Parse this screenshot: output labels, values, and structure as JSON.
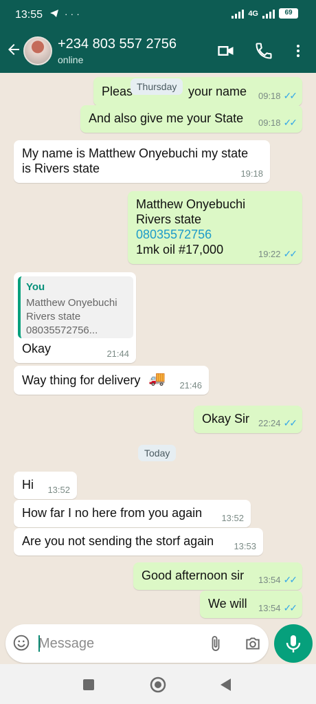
{
  "status_bar": {
    "time": "13:55",
    "network": "4G",
    "battery": "69"
  },
  "header": {
    "contact_name": "+234 803 557 2756",
    "contact_status": "online"
  },
  "messages": [
    {
      "id": "m1",
      "dir": "out",
      "text": "Pleas",
      "text2": "your name",
      "time": "09:18",
      "ticks": "✓✓"
    },
    {
      "id": "m2",
      "dir": "out",
      "text": "And also give me your State",
      "time": "09:18",
      "ticks": "✓✓"
    },
    {
      "id": "m3",
      "dir": "in",
      "text": "My name is Matthew Onyebuchi my state\nis Rivers state",
      "time": "19:18"
    },
    {
      "id": "m4",
      "dir": "out",
      "line1": "Matthew Onyebuchi",
      "line2": "Rivers state",
      "phone": "08035572756",
      "line4": "1mk oil #17,000",
      "time": "19:22",
      "ticks": "✓✓"
    },
    {
      "id": "m5",
      "dir": "in",
      "quote_author": "You",
      "quote_lines": [
        "Matthew Onyebuchi",
        "Rivers state",
        "08035572756..."
      ],
      "text": "Okay",
      "time": "21:44"
    },
    {
      "id": "m6",
      "dir": "in",
      "text": "Way thing for delivery",
      "emoji": "🚚",
      "time": "21:46"
    },
    {
      "id": "m7",
      "dir": "out",
      "text": "Okay Sir",
      "time": "22:24",
      "ticks": "✓✓"
    },
    {
      "id": "m8",
      "dir": "in",
      "text": "Hi",
      "time": "13:52"
    },
    {
      "id": "m9",
      "dir": "in",
      "text": "How far I no here from you again",
      "time": "13:52"
    },
    {
      "id": "m10",
      "dir": "in",
      "text": "Are you not sending the storf again",
      "time": "13:53"
    },
    {
      "id": "m11",
      "dir": "out",
      "text": "Good afternoon sir",
      "time": "13:54",
      "ticks": "✓✓"
    },
    {
      "id": "m12",
      "dir": "out",
      "text": "We will",
      "time": "13:54",
      "ticks": "✓✓"
    }
  ],
  "day_labels": {
    "thursday": "Thursday",
    "today": "Today"
  },
  "composer": {
    "placeholder": "Message"
  },
  "colors": {
    "header": "#0d5c53",
    "outgoing": "#dcf8c6",
    "incoming": "#ffffff",
    "accent": "#06a07c",
    "read_ticks": "#35a7e8"
  },
  "icons": {
    "back": "arrow-left-icon",
    "video": "video-call-icon",
    "call": "phone-icon",
    "menu": "more-vertical-icon",
    "emoji": "emoji-icon",
    "attach": "paperclip-icon",
    "camera": "camera-icon",
    "mic": "mic-icon"
  }
}
